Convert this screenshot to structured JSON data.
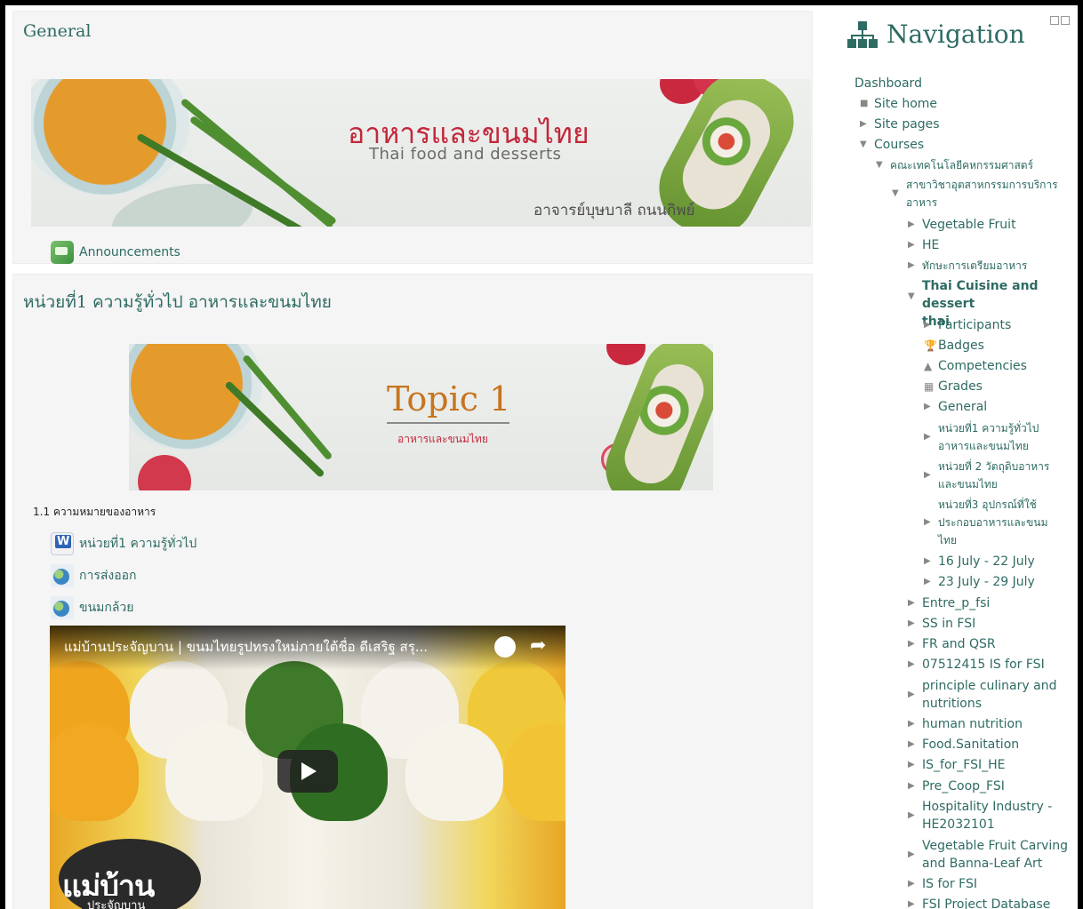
{
  "main": {
    "general": {
      "title": "General",
      "banner_title_th": "อาหารและขนมไทย",
      "banner_title_en": "Thai food and desserts",
      "banner_teacher": "อาจารย์บุษบาลี ถนนกิพย์",
      "announcements_label": "Announcements"
    },
    "unit1": {
      "title": "หน่วยที่1 ความรู้ทั่วไป อาหารและขนมไทย",
      "topic_heading": "Topic 1",
      "topic_sub": "อาหารและขนมไทย",
      "label_text": "1.1 ความหมายของอาหาร",
      "activities": [
        {
          "label": "หน่วยที่1 ความรู้ทั่วไป"
        },
        {
          "label": "การส่งออก"
        },
        {
          "label": "ขนมกล้วย"
        }
      ],
      "video": {
        "title": "แม่บ้านประจัญบาน | ขนมไทยรูปทรงใหม่ภายใต้ชื่อ ดีเสริฐ สรุ...",
        "logo_main": "แม่บ้าน",
        "logo_sub": "ประจัญบาน"
      }
    }
  },
  "nav": {
    "title": "Navigation",
    "items": [
      {
        "label": "Dashboard"
      },
      {
        "label": "Site home"
      },
      {
        "label": "Site pages"
      },
      {
        "label": "Courses"
      },
      {
        "label": "คณะเทคโนโลยีคหกรรมศาสตร์"
      },
      {
        "label": "สาขาวิชาอุตสาหกรรมการบริการ",
        "label2": "อาหาร"
      },
      {
        "label": "Vegetable Fruit"
      },
      {
        "label": "HE"
      },
      {
        "label": "ทักษะการเตรียมอาหาร"
      },
      {
        "label": "Thai Cuisine and dessert",
        "label2": "thai"
      },
      {
        "label": "Participants"
      },
      {
        "label": "Badges"
      },
      {
        "label": "Competencies"
      },
      {
        "label": "Grades"
      },
      {
        "label": "General"
      },
      {
        "label": "หน่วยที่1 ความรู้ทั่วไป",
        "label2": "อาหารและขนมไทย"
      },
      {
        "label": "หน่วยที่ 2 วัตถุดิบอาหาร",
        "label2": "และขนมไทย"
      },
      {
        "label": "หน่วยที่3 อุปกรณ์ที่ใช้",
        "label2": "ประกอบอาหารและขนม",
        "label3": "ไทย"
      },
      {
        "label": "16 July - 22 July"
      },
      {
        "label": "23 July - 29 July"
      },
      {
        "label": "Entre_p_fsi"
      },
      {
        "label": "SS in FSI"
      },
      {
        "label": "FR and QSR"
      },
      {
        "label": "07512415 IS for FSI"
      },
      {
        "label": "principle culinary and",
        "label2": "nutritions"
      },
      {
        "label": "human nutrition"
      },
      {
        "label": "Food.Sanitation"
      },
      {
        "label": "IS_for_FSI_HE"
      },
      {
        "label": "Pre_Coop_FSI"
      },
      {
        "label": "Hospitality Industry -",
        "label2": "HE2032101"
      },
      {
        "label": "Vegetable Fruit Carving",
        "label2": "and Banna-Leaf Art"
      },
      {
        "label": "IS for FSI"
      },
      {
        "label": "FSI Project Database"
      }
    ]
  }
}
